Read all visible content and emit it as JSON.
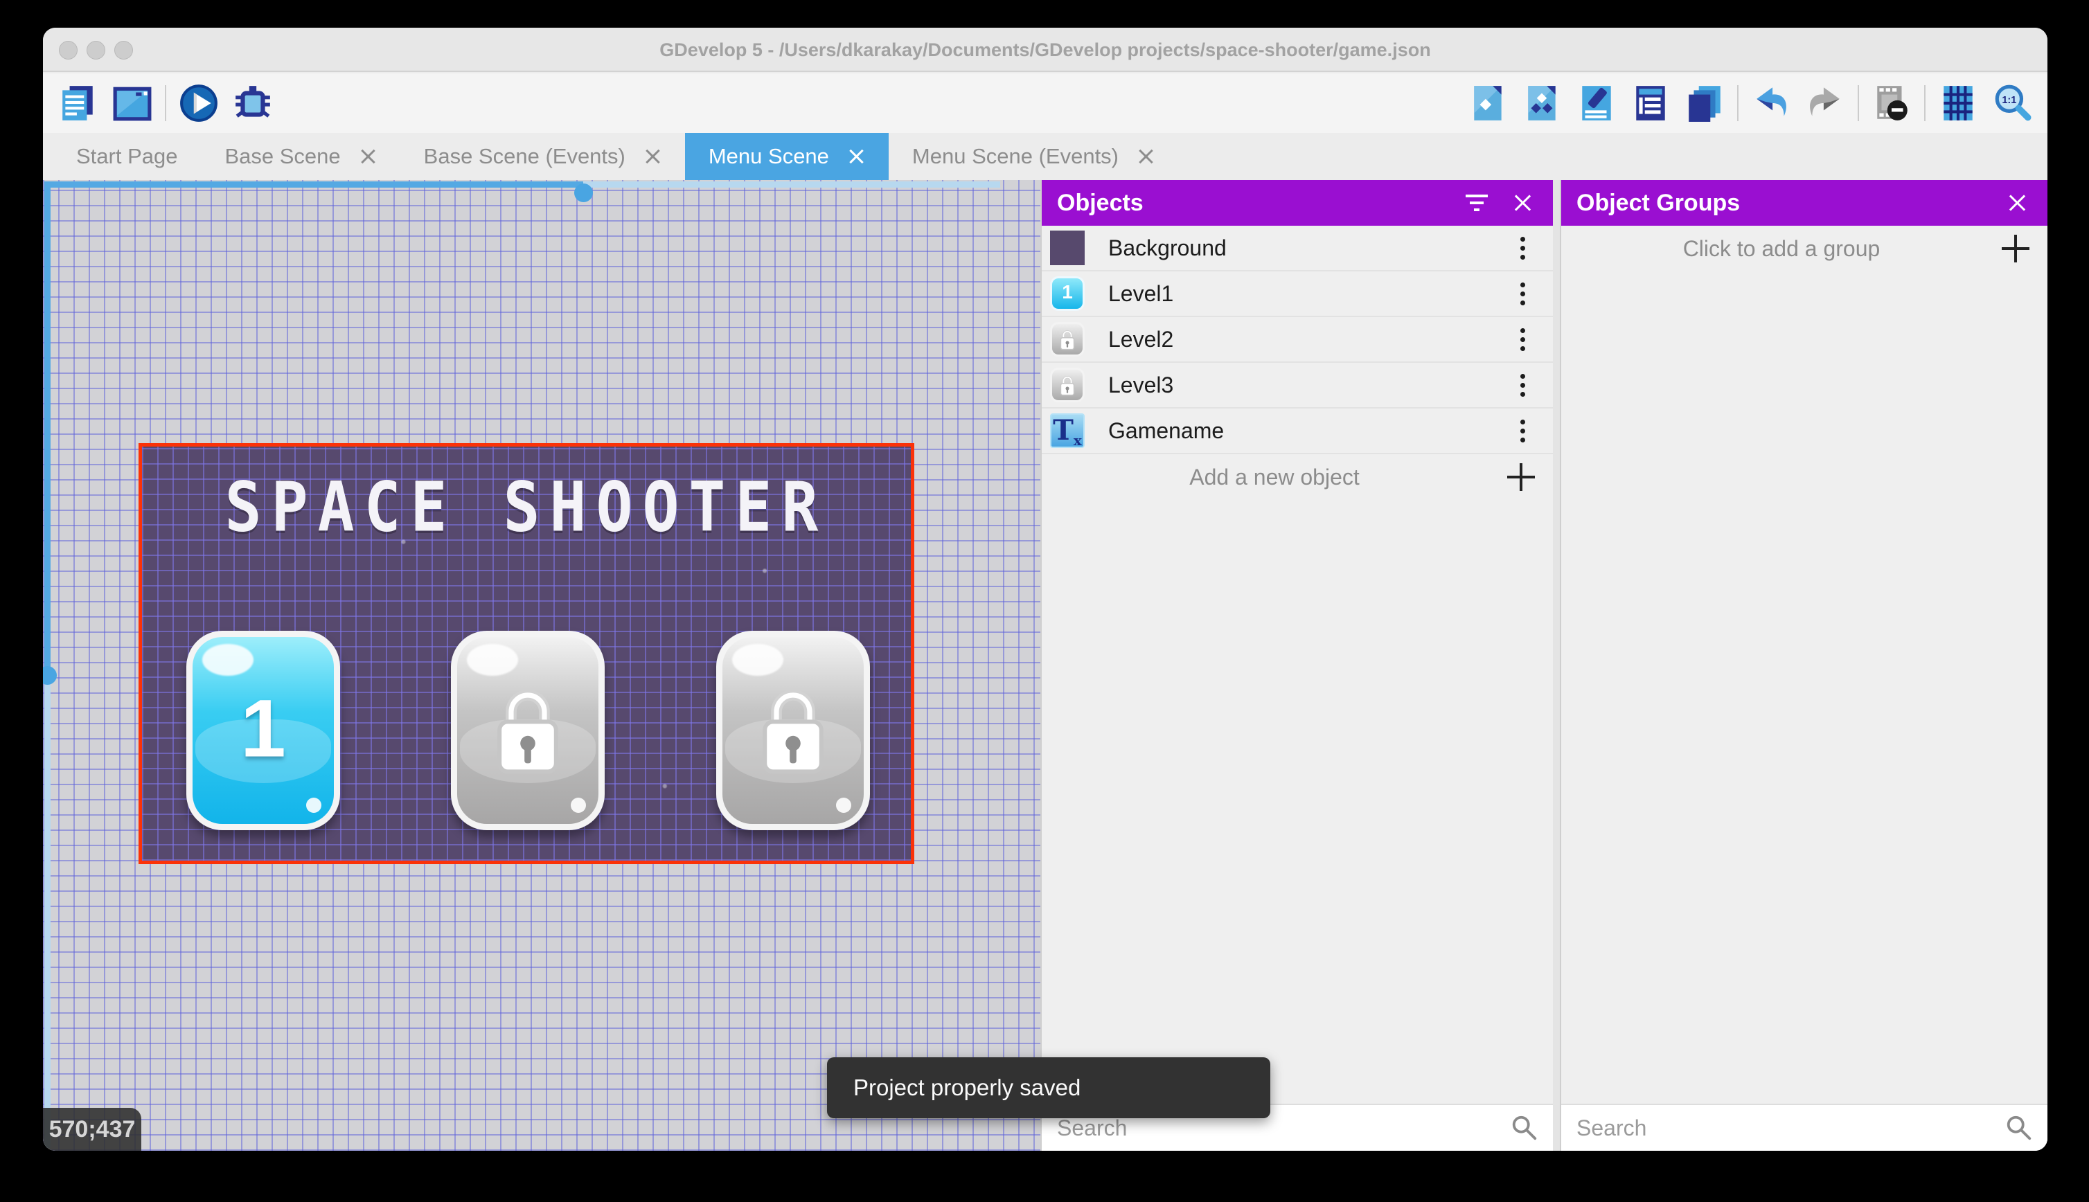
{
  "window": {
    "title": "GDevelop 5 - /Users/dkarakay/Documents/GDevelop projects/space-shooter/game.json"
  },
  "toolbar": {
    "left": [
      "project-manager",
      "scene-editor",
      "play",
      "debug"
    ],
    "right": [
      "export-project",
      "objects-list",
      "edit-scene-properties",
      "instances-list",
      "layers",
      "undo",
      "redo",
      "render-mask",
      "grid",
      "zoom-one-to-one"
    ],
    "zoom_icon_label": "1:1"
  },
  "tabs": [
    {
      "label": "Start Page",
      "closable": false,
      "active": false
    },
    {
      "label": "Base Scene",
      "closable": true,
      "active": false
    },
    {
      "label": "Base Scene (Events)",
      "closable": true,
      "active": false
    },
    {
      "label": "Menu Scene",
      "closable": true,
      "active": true
    },
    {
      "label": "Menu Scene (Events)",
      "closable": true,
      "active": false
    }
  ],
  "canvas": {
    "coordinates": "570;437",
    "scene": {
      "title": "SPACE SHOOTER",
      "buttons": [
        {
          "label": "1",
          "state": "unlocked"
        },
        {
          "label": "",
          "state": "locked"
        },
        {
          "label": "",
          "state": "locked"
        }
      ]
    }
  },
  "objects_panel": {
    "title": "Objects",
    "items": [
      {
        "name": "Background",
        "icon": "background-swatch"
      },
      {
        "name": "Level1",
        "icon": "button-1",
        "icon_text": "1"
      },
      {
        "name": "Level2",
        "icon": "locked-button"
      },
      {
        "name": "Level3",
        "icon": "locked-button"
      },
      {
        "name": "Gamename",
        "icon": "text-object",
        "icon_t": "T",
        "icon_x": "x"
      }
    ],
    "add_label": "Add a new object",
    "search_placeholder": "Search"
  },
  "object_groups_panel": {
    "title": "Object Groups",
    "empty_label": "Click to add a group",
    "search_placeholder": "Search"
  },
  "toast": {
    "message": "Project properly saved"
  },
  "colors": {
    "accent_blue": "#4aa5e2",
    "panel_purple": "#9a0fd1",
    "selection_red": "#fb3208",
    "scene_purple": "#57496e"
  }
}
